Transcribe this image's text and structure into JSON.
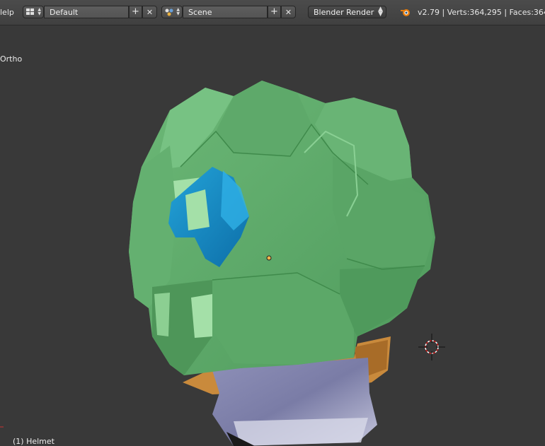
{
  "header": {
    "menu_help": "lelp",
    "layout": {
      "editor_icon": "screen-layout-icon",
      "name": "Default",
      "add": "+",
      "close": "✕"
    },
    "scene": {
      "editor_icon": "scene-icon",
      "name": "Scene",
      "add": "+",
      "close": "✕"
    },
    "render_engine": {
      "selected": "Blender Render"
    },
    "stats": "v2.79 | Verts:364,295 | Faces:364,"
  },
  "viewport": {
    "view_label": "Ortho",
    "object_label": "(1) Helmet",
    "object_name": "Helmet",
    "colors": {
      "background": "#393939",
      "helmet_green": "#5fa86a",
      "visor_blue": "#1e86c0",
      "neck_grey": "#7d7fa6",
      "strap_orange": "#c98a3c"
    },
    "icons": [
      "3d-cursor-icon",
      "object-origin-icon"
    ]
  }
}
